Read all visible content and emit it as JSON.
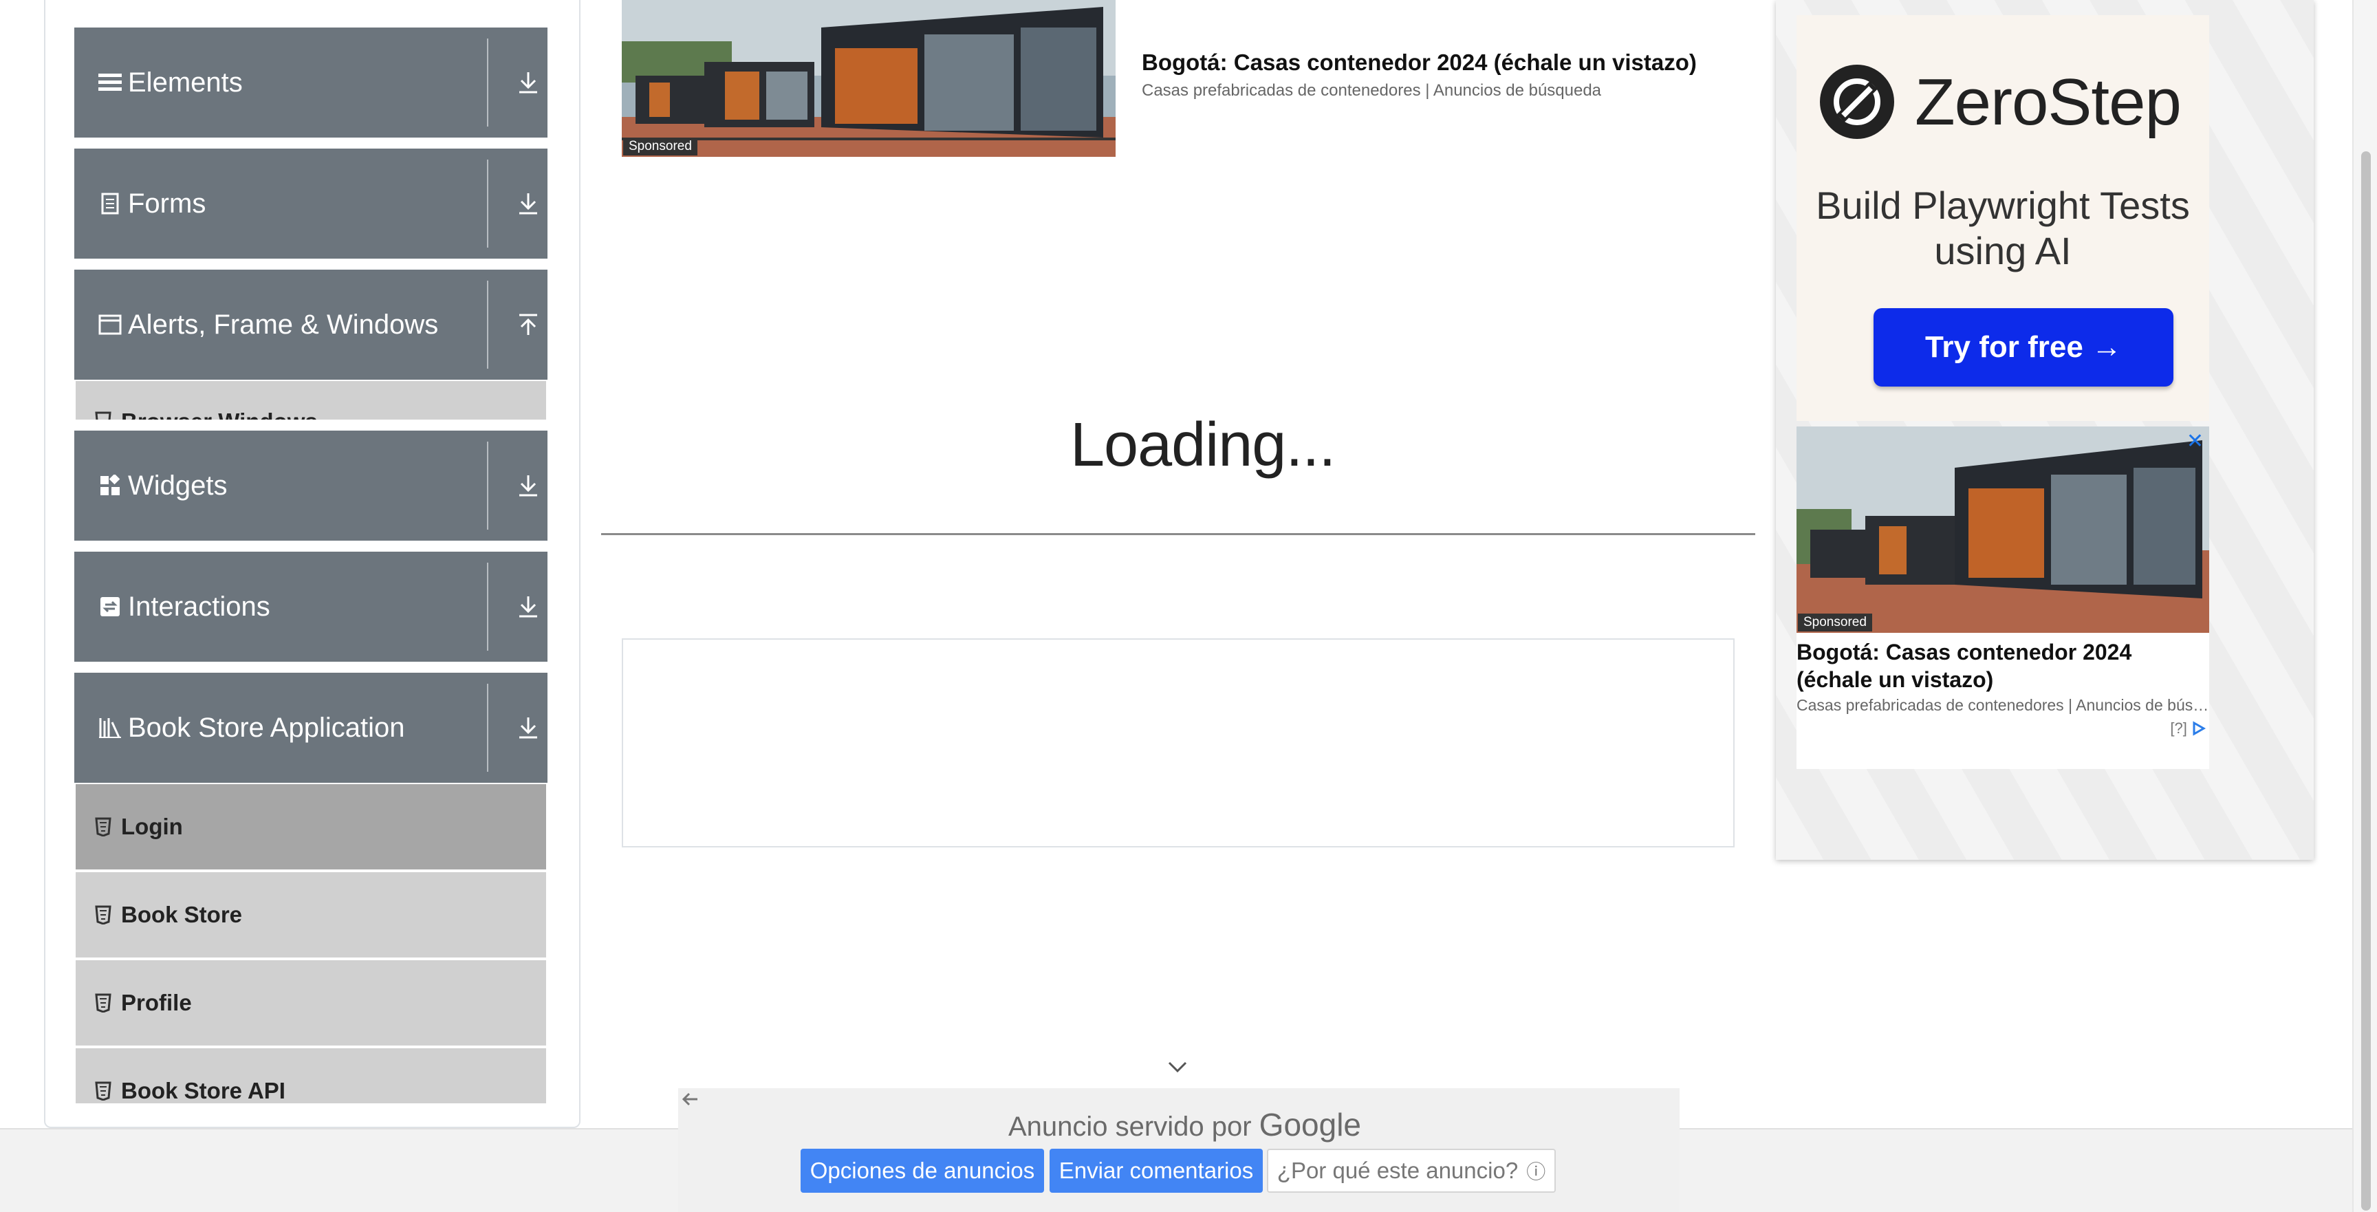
{
  "sidebar": {
    "groups": [
      {
        "label": "Elements",
        "icon": "hamburger-icon",
        "state": "collapsed"
      },
      {
        "label": "Forms",
        "icon": "document-icon",
        "state": "collapsed"
      },
      {
        "label": "Alerts, Frame & Windows",
        "icon": "window-icon",
        "state": "expanded"
      },
      {
        "label": "Widgets",
        "icon": "widgets-icon",
        "state": "collapsed"
      },
      {
        "label": "Interactions",
        "icon": "interactions-icon",
        "state": "collapsed"
      },
      {
        "label": "Book Store Application",
        "icon": "books-icon",
        "state": "expanded"
      }
    ],
    "alerts_partial_item": "Browser Windows",
    "bookstore_items": [
      {
        "label": "Login",
        "active": true
      },
      {
        "label": "Book Store",
        "active": false
      },
      {
        "label": "Profile",
        "active": false
      },
      {
        "label": "Book Store API",
        "active": false
      }
    ]
  },
  "top_ad": {
    "sponsored": "Sponsored",
    "title": "Bogotá: Casas contenedor 2024 (échale un vistazo)",
    "subtitle": "Casas prefabricadas de contenedores | Anuncios de búsqueda"
  },
  "main": {
    "loading_text": "Loading..."
  },
  "right_ad": {
    "brand": "ZeroStep",
    "tagline": "Build Playwright Tests using AI",
    "cta": "Try for free →",
    "card_sponsored": "Sponsored",
    "card_title": "Bogotá: Casas contenedor 2024 (échale un vistazo)",
    "card_subtitle": "Casas prefabricadas de contenedores | Anuncios de búsqueda",
    "close_glyph": "✕",
    "adchoices": "[?]",
    "cta_color": "#0d2bea"
  },
  "google_ad_bar": {
    "served_by": "Anuncio servido por",
    "google": "Google",
    "options_button": "Opciones de anuncios",
    "feedback_button": "Enviar comentarios",
    "why_button": "¿Por qué este anuncio?",
    "why_icon": "ⓘ",
    "button_color": "#4285f4"
  }
}
